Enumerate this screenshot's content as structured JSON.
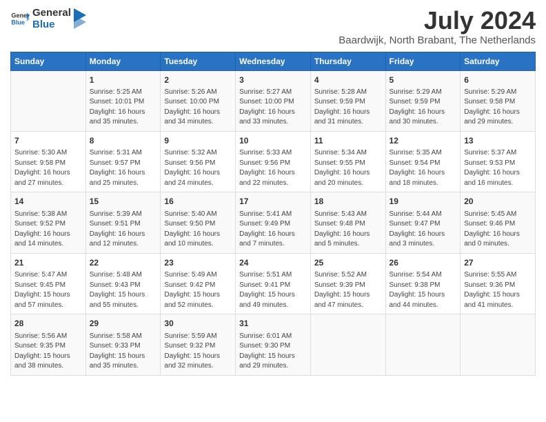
{
  "logo": {
    "line1": "General",
    "line2": "Blue"
  },
  "title": "July 2024",
  "location": "Baardwijk, North Brabant, The Netherlands",
  "days_of_week": [
    "Sunday",
    "Monday",
    "Tuesday",
    "Wednesday",
    "Thursday",
    "Friday",
    "Saturday"
  ],
  "weeks": [
    [
      {
        "day": "",
        "info": ""
      },
      {
        "day": "1",
        "info": "Sunrise: 5:25 AM\nSunset: 10:01 PM\nDaylight: 16 hours\nand 35 minutes."
      },
      {
        "day": "2",
        "info": "Sunrise: 5:26 AM\nSunset: 10:00 PM\nDaylight: 16 hours\nand 34 minutes."
      },
      {
        "day": "3",
        "info": "Sunrise: 5:27 AM\nSunset: 10:00 PM\nDaylight: 16 hours\nand 33 minutes."
      },
      {
        "day": "4",
        "info": "Sunrise: 5:28 AM\nSunset: 9:59 PM\nDaylight: 16 hours\nand 31 minutes."
      },
      {
        "day": "5",
        "info": "Sunrise: 5:29 AM\nSunset: 9:59 PM\nDaylight: 16 hours\nand 30 minutes."
      },
      {
        "day": "6",
        "info": "Sunrise: 5:29 AM\nSunset: 9:58 PM\nDaylight: 16 hours\nand 29 minutes."
      }
    ],
    [
      {
        "day": "7",
        "info": "Sunrise: 5:30 AM\nSunset: 9:58 PM\nDaylight: 16 hours\nand 27 minutes."
      },
      {
        "day": "8",
        "info": "Sunrise: 5:31 AM\nSunset: 9:57 PM\nDaylight: 16 hours\nand 25 minutes."
      },
      {
        "day": "9",
        "info": "Sunrise: 5:32 AM\nSunset: 9:56 PM\nDaylight: 16 hours\nand 24 minutes."
      },
      {
        "day": "10",
        "info": "Sunrise: 5:33 AM\nSunset: 9:56 PM\nDaylight: 16 hours\nand 22 minutes."
      },
      {
        "day": "11",
        "info": "Sunrise: 5:34 AM\nSunset: 9:55 PM\nDaylight: 16 hours\nand 20 minutes."
      },
      {
        "day": "12",
        "info": "Sunrise: 5:35 AM\nSunset: 9:54 PM\nDaylight: 16 hours\nand 18 minutes."
      },
      {
        "day": "13",
        "info": "Sunrise: 5:37 AM\nSunset: 9:53 PM\nDaylight: 16 hours\nand 16 minutes."
      }
    ],
    [
      {
        "day": "14",
        "info": "Sunrise: 5:38 AM\nSunset: 9:52 PM\nDaylight: 16 hours\nand 14 minutes."
      },
      {
        "day": "15",
        "info": "Sunrise: 5:39 AM\nSunset: 9:51 PM\nDaylight: 16 hours\nand 12 minutes."
      },
      {
        "day": "16",
        "info": "Sunrise: 5:40 AM\nSunset: 9:50 PM\nDaylight: 16 hours\nand 10 minutes."
      },
      {
        "day": "17",
        "info": "Sunrise: 5:41 AM\nSunset: 9:49 PM\nDaylight: 16 hours\nand 7 minutes."
      },
      {
        "day": "18",
        "info": "Sunrise: 5:43 AM\nSunset: 9:48 PM\nDaylight: 16 hours\nand 5 minutes."
      },
      {
        "day": "19",
        "info": "Sunrise: 5:44 AM\nSunset: 9:47 PM\nDaylight: 16 hours\nand 3 minutes."
      },
      {
        "day": "20",
        "info": "Sunrise: 5:45 AM\nSunset: 9:46 PM\nDaylight: 16 hours\nand 0 minutes."
      }
    ],
    [
      {
        "day": "21",
        "info": "Sunrise: 5:47 AM\nSunset: 9:45 PM\nDaylight: 15 hours\nand 57 minutes."
      },
      {
        "day": "22",
        "info": "Sunrise: 5:48 AM\nSunset: 9:43 PM\nDaylight: 15 hours\nand 55 minutes."
      },
      {
        "day": "23",
        "info": "Sunrise: 5:49 AM\nSunset: 9:42 PM\nDaylight: 15 hours\nand 52 minutes."
      },
      {
        "day": "24",
        "info": "Sunrise: 5:51 AM\nSunset: 9:41 PM\nDaylight: 15 hours\nand 49 minutes."
      },
      {
        "day": "25",
        "info": "Sunrise: 5:52 AM\nSunset: 9:39 PM\nDaylight: 15 hours\nand 47 minutes."
      },
      {
        "day": "26",
        "info": "Sunrise: 5:54 AM\nSunset: 9:38 PM\nDaylight: 15 hours\nand 44 minutes."
      },
      {
        "day": "27",
        "info": "Sunrise: 5:55 AM\nSunset: 9:36 PM\nDaylight: 15 hours\nand 41 minutes."
      }
    ],
    [
      {
        "day": "28",
        "info": "Sunrise: 5:56 AM\nSunset: 9:35 PM\nDaylight: 15 hours\nand 38 minutes."
      },
      {
        "day": "29",
        "info": "Sunrise: 5:58 AM\nSunset: 9:33 PM\nDaylight: 15 hours\nand 35 minutes."
      },
      {
        "day": "30",
        "info": "Sunrise: 5:59 AM\nSunset: 9:32 PM\nDaylight: 15 hours\nand 32 minutes."
      },
      {
        "day": "31",
        "info": "Sunrise: 6:01 AM\nSunset: 9:30 PM\nDaylight: 15 hours\nand 29 minutes."
      },
      {
        "day": "",
        "info": ""
      },
      {
        "day": "",
        "info": ""
      },
      {
        "day": "",
        "info": ""
      }
    ]
  ]
}
